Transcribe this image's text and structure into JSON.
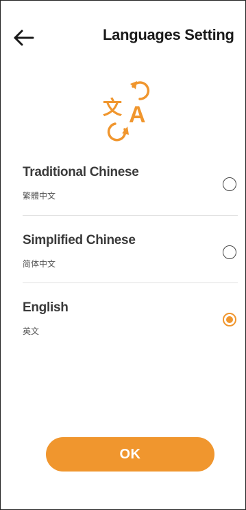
{
  "header": {
    "back_icon": "arrow-left-icon",
    "title": "Languages Setting"
  },
  "hero_icon": "translate-icon",
  "languages": [
    {
      "label": "Traditional Chinese",
      "native": "繁體中文",
      "selected": false
    },
    {
      "label": "Simplified Chinese",
      "native": "简体中文",
      "selected": false
    },
    {
      "label": "English",
      "native": "英文",
      "selected": true
    }
  ],
  "actions": {
    "ok_label": "OK"
  },
  "colors": {
    "accent": "#F0962E",
    "text_primary": "#1a1a1a",
    "radio_border": "#444444",
    "divider": "#e2e2e2"
  }
}
